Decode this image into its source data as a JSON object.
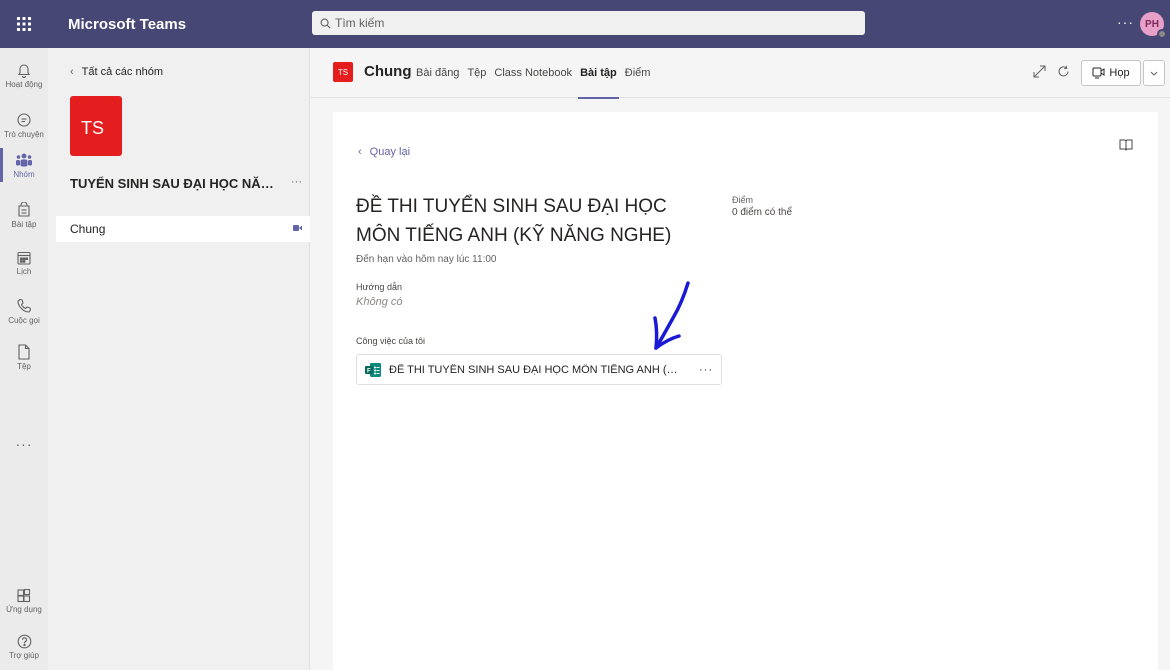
{
  "app": {
    "title": "Microsoft Teams",
    "search_placeholder": "Tìm kiếm",
    "user_initials": "PH"
  },
  "rail": {
    "items": [
      {
        "label": "Hoạt động",
        "icon": "bell-icon"
      },
      {
        "label": "Trò chuyện",
        "icon": "chat-icon"
      },
      {
        "label": "Nhóm",
        "icon": "teams-icon",
        "active": true
      },
      {
        "label": "Bài tập",
        "icon": "assignments-icon"
      },
      {
        "label": "Lịch",
        "icon": "calendar-icon"
      },
      {
        "label": "Cuộc gọi",
        "icon": "phone-icon"
      },
      {
        "label": "Tệp",
        "icon": "file-icon"
      },
      {
        "label": "Ứng dụng",
        "icon": "apps-icon"
      },
      {
        "label": "Trợ giúp",
        "icon": "help-icon"
      }
    ],
    "more": "···"
  },
  "panel": {
    "back_label": "Tất cả các nhóm",
    "team_initials": "TS",
    "team_name": "TUYỂN SINH SAU ĐẠI HỌC NĂM...",
    "team_more": "···",
    "channel": "Chung"
  },
  "channel_header": {
    "badge": "TS",
    "name": "Chung",
    "tabs": [
      {
        "label": "Bài đăng"
      },
      {
        "label": "Tệp"
      },
      {
        "label": "Class Notebook"
      },
      {
        "label": "Bài tập",
        "active": true
      },
      {
        "label": "Điểm"
      }
    ],
    "meet_label": "Họp"
  },
  "assignment": {
    "back_label": "Quay lại",
    "title": "ĐỀ THI TUYỂN SINH SAU ĐẠI HỌC MÔN TIẾNG ANH (KỸ NĂNG NGHE)",
    "due": "Đến hạn vào hôm nay lúc 11:00",
    "instructions_label": "Hướng dẫn",
    "instructions_value": "Không có",
    "my_work_label": "Công việc của tôi",
    "file_name": "ĐỀ THI TUYỂN SINH SAU ĐẠI HỌC MÔN TIẾNG ANH (KỸ NĂNG...",
    "file_more": "···",
    "points_label": "Điểm",
    "points_value": "0 điểm có thể"
  },
  "colors": {
    "topbar": "#464775",
    "accent": "#6264a7",
    "team_red": "#e41e1e",
    "annotation": "#1a1ad6"
  }
}
